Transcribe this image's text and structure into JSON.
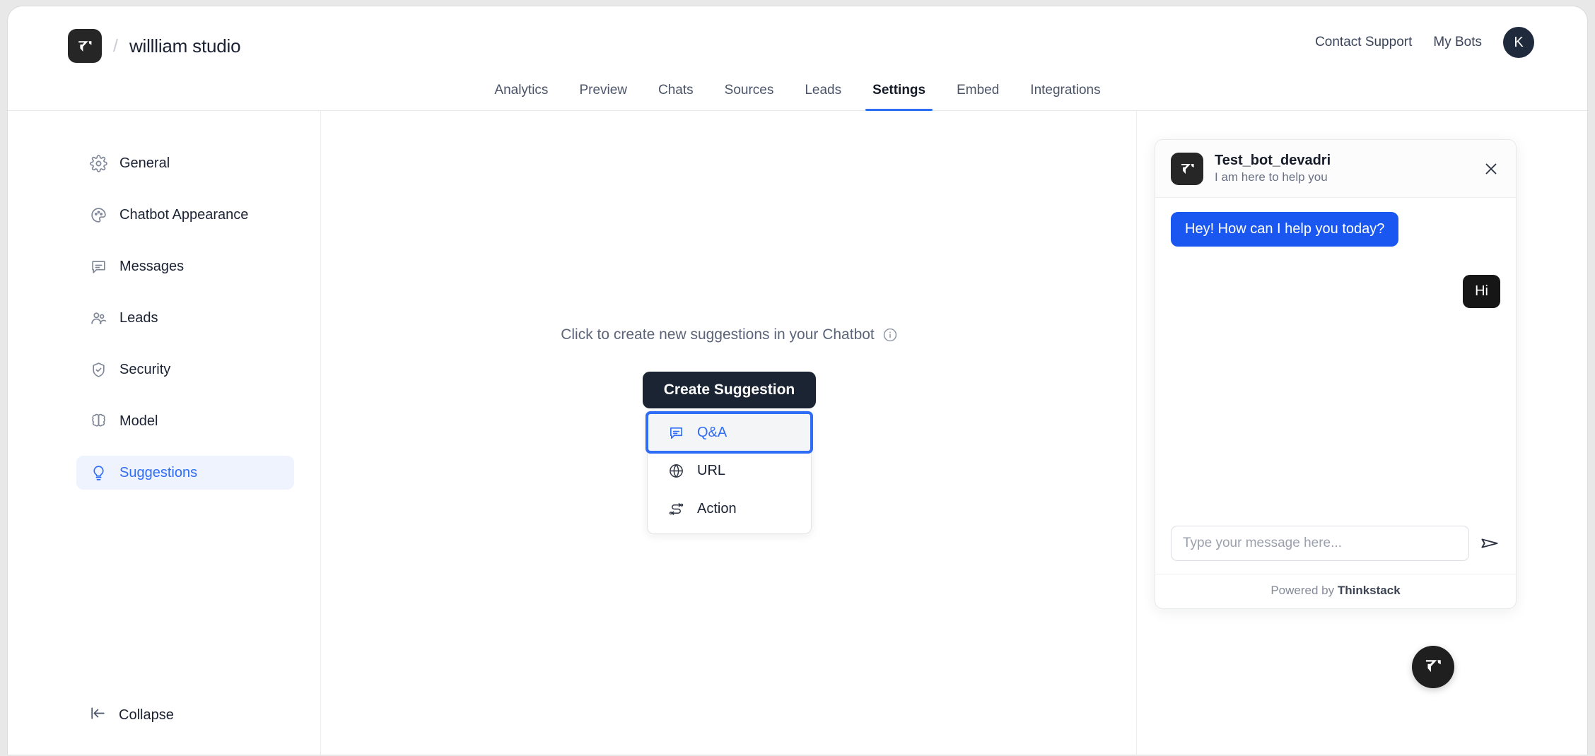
{
  "header": {
    "logo_icon": "thinkstack-logo-icon",
    "separator": "/",
    "workspace_name": "willliam studio",
    "contact_support": "Contact Support",
    "my_bots": "My Bots",
    "avatar_initial": "K"
  },
  "nav": {
    "tabs": [
      {
        "label": "Analytics",
        "active": false
      },
      {
        "label": "Preview",
        "active": false
      },
      {
        "label": "Chats",
        "active": false
      },
      {
        "label": "Sources",
        "active": false
      },
      {
        "label": "Leads",
        "active": false
      },
      {
        "label": "Settings",
        "active": true
      },
      {
        "label": "Embed",
        "active": false
      },
      {
        "label": "Integrations",
        "active": false
      }
    ],
    "active_underline_color": "#2f6df6"
  },
  "sidebar": {
    "items": [
      {
        "label": "General",
        "icon": "gear-icon",
        "active": false
      },
      {
        "label": "Chatbot Appearance",
        "icon": "palette-icon",
        "active": false
      },
      {
        "label": "Messages",
        "icon": "message-icon",
        "active": false
      },
      {
        "label": "Leads",
        "icon": "users-icon",
        "active": false
      },
      {
        "label": "Security",
        "icon": "shield-check-icon",
        "active": false
      },
      {
        "label": "Model",
        "icon": "brain-icon",
        "active": false
      },
      {
        "label": "Suggestions",
        "icon": "lightbulb-icon",
        "active": true
      }
    ],
    "collapse": {
      "label": "Collapse",
      "icon": "collapse-left-icon"
    },
    "active_color": "#2f6df6",
    "active_bg": "#eef3fd"
  },
  "main": {
    "hint_text": "Click to create new suggestions in your Chatbot",
    "info_icon": "info-circle-icon",
    "create_button": "Create Suggestion",
    "dropdown": {
      "items": [
        {
          "label": "Q&A",
          "icon": "message-icon",
          "selected": true
        },
        {
          "label": "URL",
          "icon": "globe-icon",
          "selected": false
        },
        {
          "label": "Action",
          "icon": "workflow-icon",
          "selected": false
        }
      ],
      "selected_outline_color": "#2f6df6"
    }
  },
  "chat_widget": {
    "bot_name": "Test_bot_devadri",
    "bot_tagline": "I am here to help you",
    "avatar_icon": "thinkstack-logo-icon",
    "close_icon": "close-icon",
    "messages": [
      {
        "from": "bot",
        "text": "Hey! How can I help you today?"
      },
      {
        "from": "user",
        "text": "Hi"
      }
    ],
    "bot_bubble_color": "#1a56f0",
    "user_bubble_color": "#161616",
    "input_placeholder": "Type your message here...",
    "input_value": "",
    "send_icon": "send-icon",
    "footer_prefix": "Powered by ",
    "footer_brand": "Thinkstack",
    "fab_icon": "thinkstack-logo-icon"
  }
}
